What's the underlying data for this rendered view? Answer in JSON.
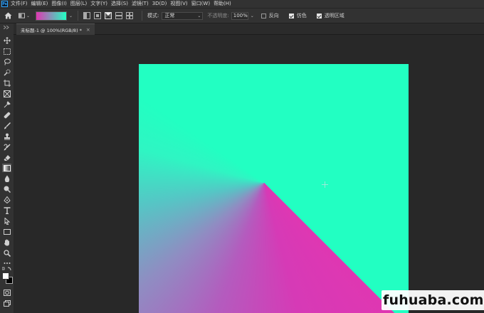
{
  "menubar": {
    "logo": "Ps",
    "items": [
      "文件(F)",
      "编辑(E)",
      "图像(I)",
      "图层(L)",
      "文字(Y)",
      "选择(S)",
      "滤镜(T)",
      "3D(D)",
      "视图(V)",
      "窗口(W)",
      "帮助(H)"
    ]
  },
  "options": {
    "gradient_colors": [
      "#df37b2",
      "#22ffc2"
    ],
    "gradient_types": [
      "linear",
      "radial",
      "angle",
      "reflected",
      "diamond"
    ],
    "active_gradient_type": "angle",
    "mode_label": "模式:",
    "mode_value": "正常",
    "opacity_label": "不透明度:",
    "opacity_value": "100%",
    "reverse_label": "反向",
    "reverse_checked": false,
    "dither_label": "仿色",
    "dither_checked": true,
    "transparency_label": "透明区域",
    "transparency_checked": true
  },
  "document": {
    "tab_title": "未标题-1 @ 100%(RGB/8) *",
    "close_glyph": "×"
  },
  "tools": [
    "move",
    "marquee",
    "lasso",
    "quick-select",
    "crop",
    "frame",
    "eyedropper",
    "healing",
    "brush",
    "stamp",
    "history-brush",
    "eraser",
    "gradient",
    "blur",
    "dodge",
    "pen",
    "type",
    "path-select",
    "rectangle",
    "hand",
    "zoom",
    "more",
    "swap-colors",
    "color-swatches",
    "quick-mask",
    "screen-mode"
  ],
  "active_tool": "gradient",
  "colors": {
    "foreground": "#ffffff",
    "background": "#000000",
    "canvas_gradient_from": "#df37b2",
    "canvas_gradient_to": "#22ffc2"
  },
  "watermark": {
    "text": "fuhuaba.com"
  }
}
